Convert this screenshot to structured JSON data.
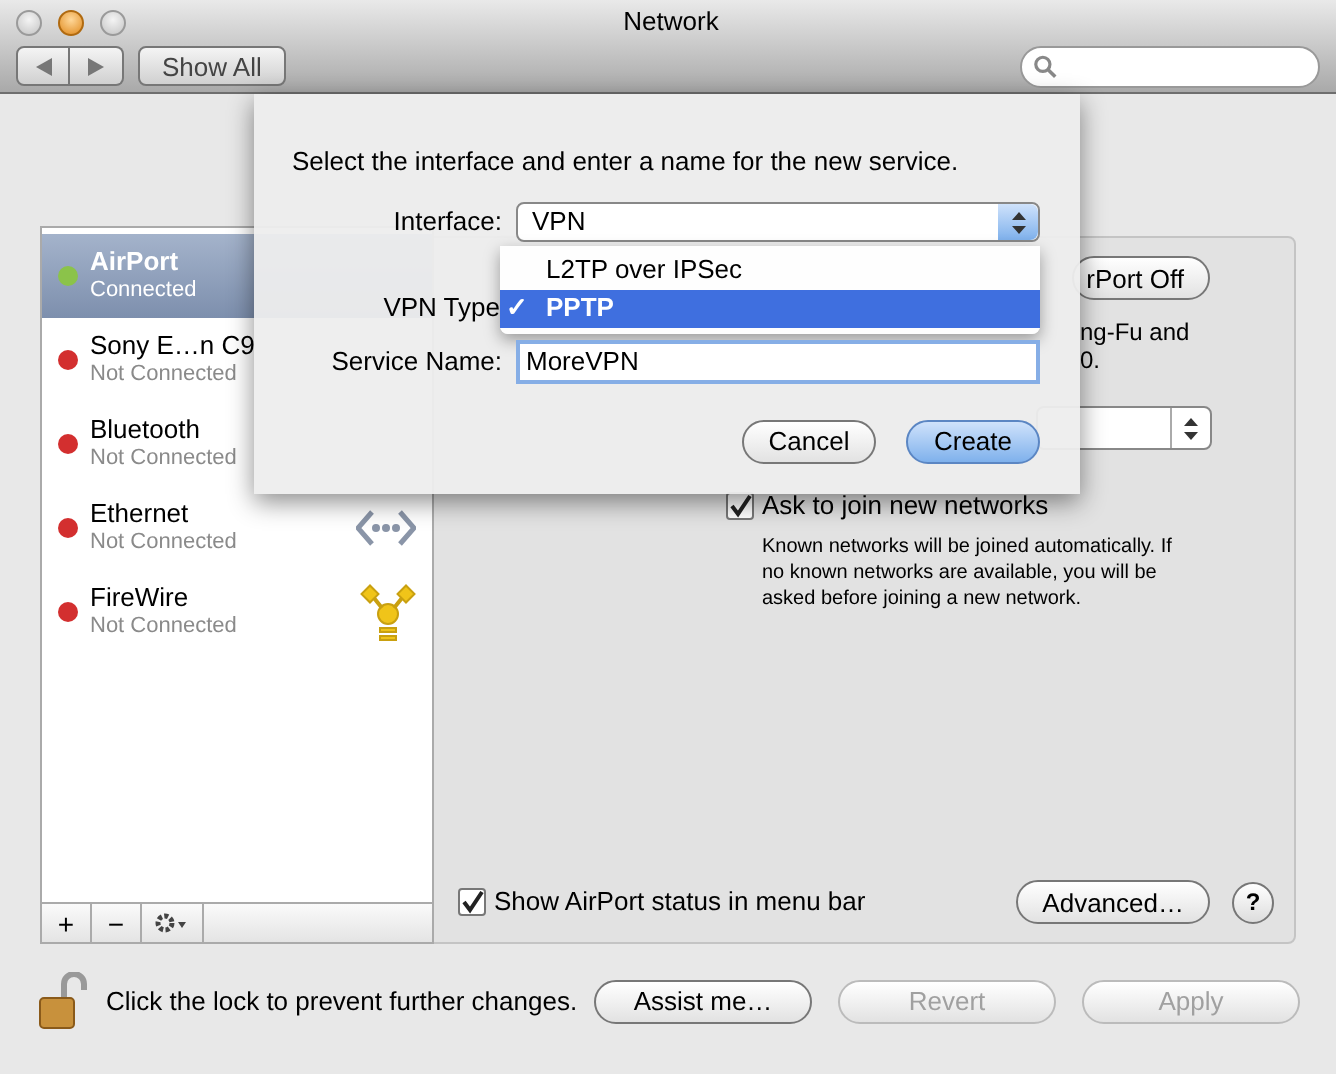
{
  "window": {
    "title": "Network",
    "traffic_lights": [
      {
        "active": false
      },
      {
        "active": true
      },
      {
        "active": false
      }
    ]
  },
  "toolbar": {
    "show_all": "Show All"
  },
  "services": [
    {
      "name": "AirPort",
      "status": "Connected",
      "color": "#8bc34a",
      "selected": true,
      "kind": "plain"
    },
    {
      "name": "Sony E…n C9",
      "status": "Not Connected",
      "color": "#d32f2f",
      "selected": false,
      "kind": "plain"
    },
    {
      "name": "Bluetooth",
      "status": "Not Connected",
      "color": "#d32f2f",
      "selected": false,
      "kind": "plain"
    },
    {
      "name": "Ethernet",
      "status": "Not Connected",
      "color": "#d32f2f",
      "selected": false,
      "kind": "ethernet"
    },
    {
      "name": "FireWire",
      "status": "Not Connected",
      "color": "#d32f2f",
      "selected": false,
      "kind": "firewire"
    }
  ],
  "list_toolbar": [
    "+",
    "−"
  ],
  "panel": {
    "power_button": "rPort Off",
    "status_lines": [
      "ng-Fu and",
      "0."
    ],
    "ask_to_join": {
      "label": "Ask to join new networks",
      "checked": true
    },
    "ask_description": "Known networks will be joined automatically. If no known networks are available, you will be asked before joining a new network.",
    "show_status": {
      "label": "Show AirPort status in menu bar",
      "checked": true
    },
    "advanced_button": "Advanced…",
    "help_button": "?"
  },
  "sheet": {
    "prompt": "Select the interface and enter a name for the new service.",
    "interface_label": "Interface:",
    "interface_value": "VPN",
    "vpn_type_label": "VPN Type",
    "vpn_type_options": [
      {
        "label": "L2TP over IPSec",
        "selected": false
      },
      {
        "label": "PPTP",
        "selected": true
      }
    ],
    "check_mark": "✓",
    "service_name_label": "Service Name:",
    "service_name_value": "MoreVPN",
    "buttons": [
      {
        "label": "Cancel",
        "default": false
      },
      {
        "label": "Create",
        "default": true
      }
    ]
  },
  "footer": {
    "lock_text": "Click the lock to prevent further changes.",
    "buttons": [
      {
        "label": "Assist me…",
        "disabled": false
      },
      {
        "label": "Revert",
        "disabled": true
      },
      {
        "label": "Apply",
        "disabled": true
      }
    ]
  }
}
